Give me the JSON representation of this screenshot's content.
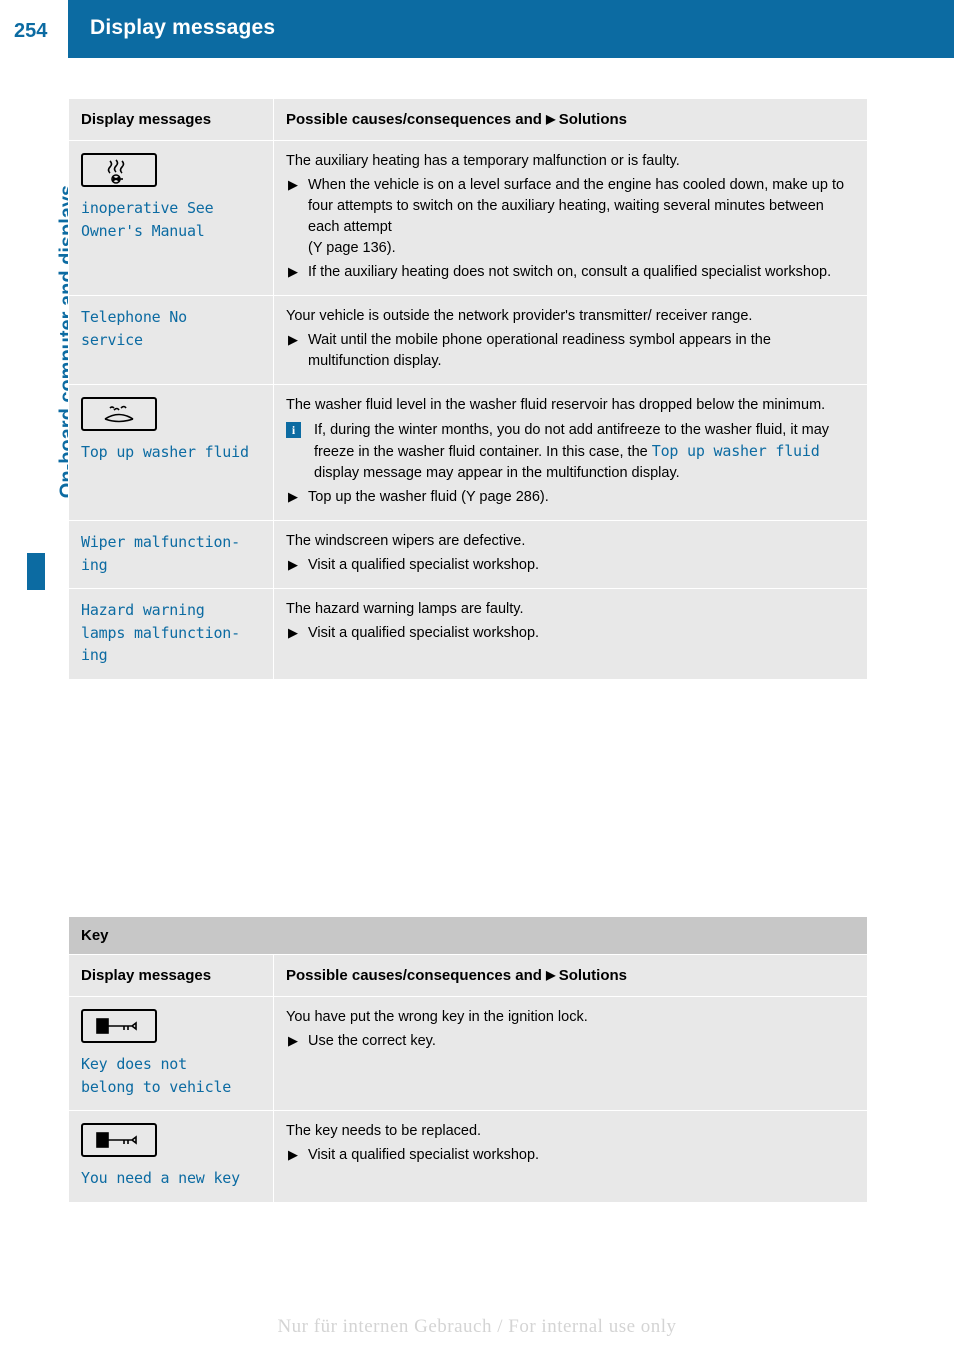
{
  "header": {
    "page_number": "254",
    "title": "Display messages",
    "chapter": "On-board computer and displays"
  },
  "table1": {
    "columns": [
      "Display messages",
      "Possible causes/consequences and",
      "Solutions"
    ],
    "rows": [
      {
        "icon": "auxiliary-heating-icon",
        "message": "inoperative See\nOwner's Manual",
        "intro": "The auxiliary heating has a temporary malfunction or is faulty.",
        "bullets": [
          "When the vehicle is on a level surface and the engine has cooled down, make up to four attempts to switch on the auxiliary heating, waiting several minutes between each attempt\n(Y page 136).",
          "If the auxiliary heating does not switch on, consult a qualified specialist workshop."
        ]
      },
      {
        "icon": "",
        "message": "Telephone No\nservice",
        "intro": "Your vehicle is outside the network provider's transmitter/ receiver range.",
        "bullets": [
          "Wait until the mobile phone operational readiness symbol appears in the multifunction display."
        ]
      },
      {
        "icon": "washer-fluid-icon",
        "message": "Top up washer fluid",
        "intro": "The washer fluid level in the washer fluid reservoir has dropped below the minimum.",
        "info_before": "If, during the winter months, you do not add antifreeze to the washer fluid, it may freeze in the washer fluid container. In this case, the ",
        "info_mono": "Top up washer fluid",
        "info_after": " display message may appear in the multifunction display.",
        "bullets": [
          "Top up the washer fluid (Y page 286)."
        ]
      },
      {
        "icon": "",
        "message": "Wiper malfunction-\ning",
        "intro": "The windscreen wipers are defective.",
        "bullets": [
          "Visit a qualified specialist workshop."
        ]
      },
      {
        "icon": "",
        "message": "Hazard warning\nlamps malfunction-\ning",
        "intro": "The hazard warning lamps are faulty.",
        "bullets": [
          "Visit a qualified specialist workshop."
        ]
      }
    ]
  },
  "table2": {
    "section_title": "Key",
    "columns": [
      "Display messages",
      "Possible causes/consequences and",
      "Solutions"
    ],
    "rows": [
      {
        "icon": "key-icon",
        "message": "Key does not\nbelong to vehicle",
        "intro": "You have put the wrong key in the ignition lock.",
        "bullets": [
          "Use the correct key."
        ]
      },
      {
        "icon": "key-icon",
        "message": "You need a new key",
        "intro": "The key needs to be replaced.",
        "bullets": [
          "Visit a qualified specialist workshop."
        ]
      }
    ]
  },
  "footer": {
    "note": "Nur für internen Gebrauch / For internal use only"
  },
  "colors": {
    "accent": "#0c6ba2",
    "row_bg": "#e8e8e8",
    "section_bg": "#c7c7c7"
  }
}
